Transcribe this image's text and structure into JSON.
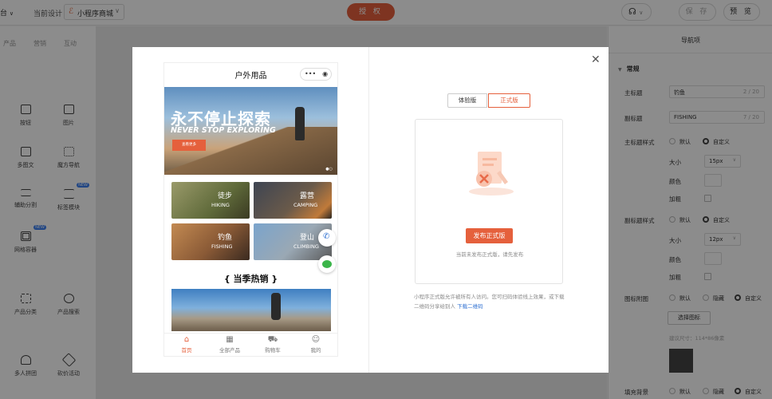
{
  "topbar": {
    "left_label": "台",
    "current_design_label": "当前设计",
    "selected_app": "小程序商城",
    "auth_label": "授 权",
    "save_label": "保 存",
    "preview_label": "预 览"
  },
  "left_panel": {
    "tabs": [
      "产品",
      "营销",
      "互动"
    ],
    "components": [
      {
        "label": "按钮",
        "icon": "button-icon"
      },
      {
        "label": "图片",
        "icon": "image-icon"
      },
      {
        "label": "多图文",
        "icon": "multi-image-icon"
      },
      {
        "label": "魔方导航",
        "icon": "grid-nav-icon"
      },
      {
        "label": "辅助分割",
        "icon": "divider-icon"
      },
      {
        "label": "标签模块",
        "icon": "tag-module-icon",
        "badge": "NEW"
      },
      {
        "label": "网格容器",
        "icon": "grid-container-icon",
        "badge": "NEW"
      },
      {
        "label": "产品分类",
        "icon": "product-category-icon"
      },
      {
        "label": "产品搜索",
        "icon": "product-search-icon"
      },
      {
        "label": "多人拼团",
        "icon": "group-buy-icon"
      },
      {
        "label": "砍价活动",
        "icon": "bargain-icon"
      }
    ]
  },
  "right_panel": {
    "title": "导航项",
    "section": "常规",
    "main_title_label": "主标题",
    "main_title_value": "钓鱼",
    "main_title_count": "2 / 20",
    "sub_title_label": "副标题",
    "sub_title_value": "FISHING",
    "sub_title_count": "7 / 20",
    "main_style_label": "主标题样式",
    "sub_style_label": "副标题样式",
    "opt_default": "默认",
    "opt_custom": "自定义",
    "opt_hidden": "隐藏",
    "size_label": "大小",
    "color_label": "颜色",
    "bold_label": "加粗",
    "main_size": "15px",
    "sub_size": "12px",
    "icon_attach_label": "图标附图",
    "select_icon_label": "选择图标",
    "suggest_size": "建议尺寸：114*86像素",
    "fill_bg_label": "填充背景"
  },
  "modal": {
    "phone": {
      "title": "户外用品",
      "banner_cn": "永不停止探索",
      "banner_en": "NEVER STOP EXPLORING",
      "banner_btn": "查看更多",
      "categories": [
        {
          "cn": "徒步",
          "en": "HIKING"
        },
        {
          "cn": "露营",
          "en": "CAMPING"
        },
        {
          "cn": "钓鱼",
          "en": "FISHING"
        },
        {
          "cn": "登山",
          "en": "CLIMBING"
        }
      ],
      "hot_title": "{ 当季热销 }",
      "tabs": [
        {
          "label": "首页",
          "icon": "home-icon"
        },
        {
          "label": "全部产品",
          "icon": "all-products-icon"
        },
        {
          "label": "购物车",
          "icon": "cart-icon"
        },
        {
          "label": "我的",
          "icon": "user-icon"
        }
      ]
    },
    "version_tabs": [
      "体验版",
      "正式版"
    ],
    "publish_button": "发布正式版",
    "publish_hint": "当前未发布正式版，请先发布",
    "note_text": "小程序正式版允许被所有人访问。您可扫码体验线上效果，或下载二维码分享给别人",
    "note_link": "下载二维码"
  },
  "colors": {
    "accent": "#e5603c",
    "link": "#2d6fd1"
  }
}
